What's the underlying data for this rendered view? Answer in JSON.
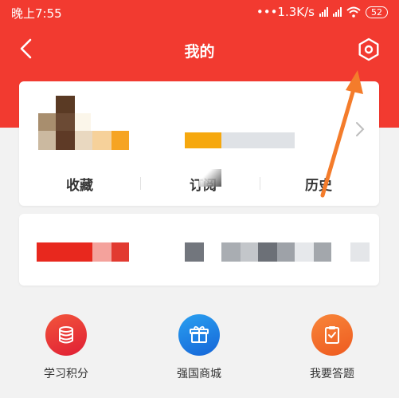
{
  "status_bar": {
    "time": "晚上7:55",
    "network_speed": "•••1.3K/s",
    "battery": "52"
  },
  "header": {
    "title": "我的"
  },
  "stats": [
    {
      "label": "收藏"
    },
    {
      "label": "订阅"
    },
    {
      "label": "历史"
    }
  ],
  "actions": [
    {
      "label": "学习积分",
      "icon": "coin-stack-icon",
      "color": "#e8323a"
    },
    {
      "label": "强国商城",
      "icon": "gift-box-icon",
      "color": "#1e88e5"
    },
    {
      "label": "我要答题",
      "icon": "quiz-clipboard-icon",
      "color": "#f26a21"
    }
  ],
  "colors": {
    "header_red": "#f23a30",
    "annotation_arrow": "#f47c2b"
  }
}
